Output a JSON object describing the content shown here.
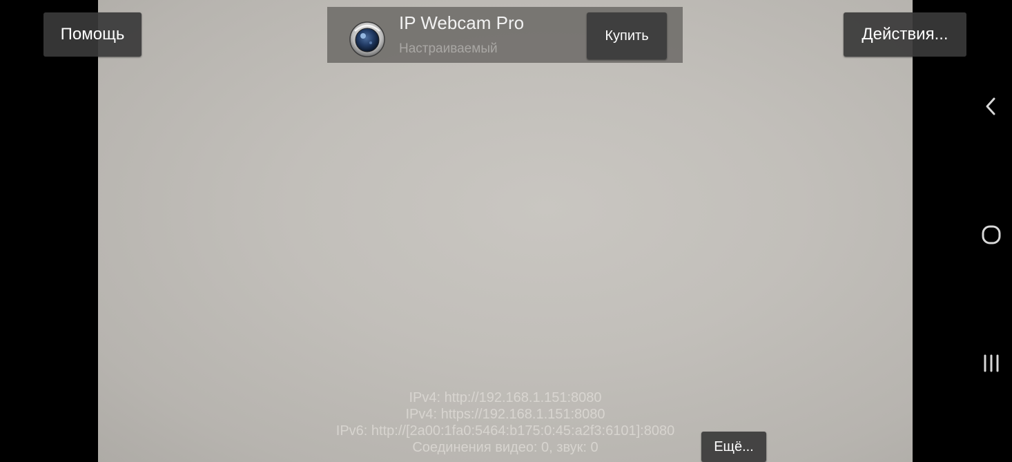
{
  "top_bar": {
    "help_label": "Помощь",
    "actions_label": "Действия..."
  },
  "ad": {
    "title": "IP Webcam Pro",
    "subtitle": "Настраиваемый",
    "buy_label": "Купить",
    "icon": "webcam-lens-icon"
  },
  "connection_info": {
    "ipv4_http": "IPv4: http://192.168.1.151:8080",
    "ipv4_https": "IPv4: https://192.168.1.151:8080",
    "ipv6_http": "IPv6: http://[2a00:1fa0:5464:b175:0:45:a2f3:6101]:8080",
    "connections": "Соединения видео: 0, звук: 0"
  },
  "bottom": {
    "more_label": "Ещё..."
  },
  "system_nav": {
    "back_icon": "back-chevron-icon",
    "home_icon": "home-icon",
    "recents_icon": "recent-apps-icon"
  },
  "colors": {
    "button_bg": "#3a3a3a",
    "preview_bg": "#c2bfba",
    "nav_icon": "#d8d8d8"
  }
}
